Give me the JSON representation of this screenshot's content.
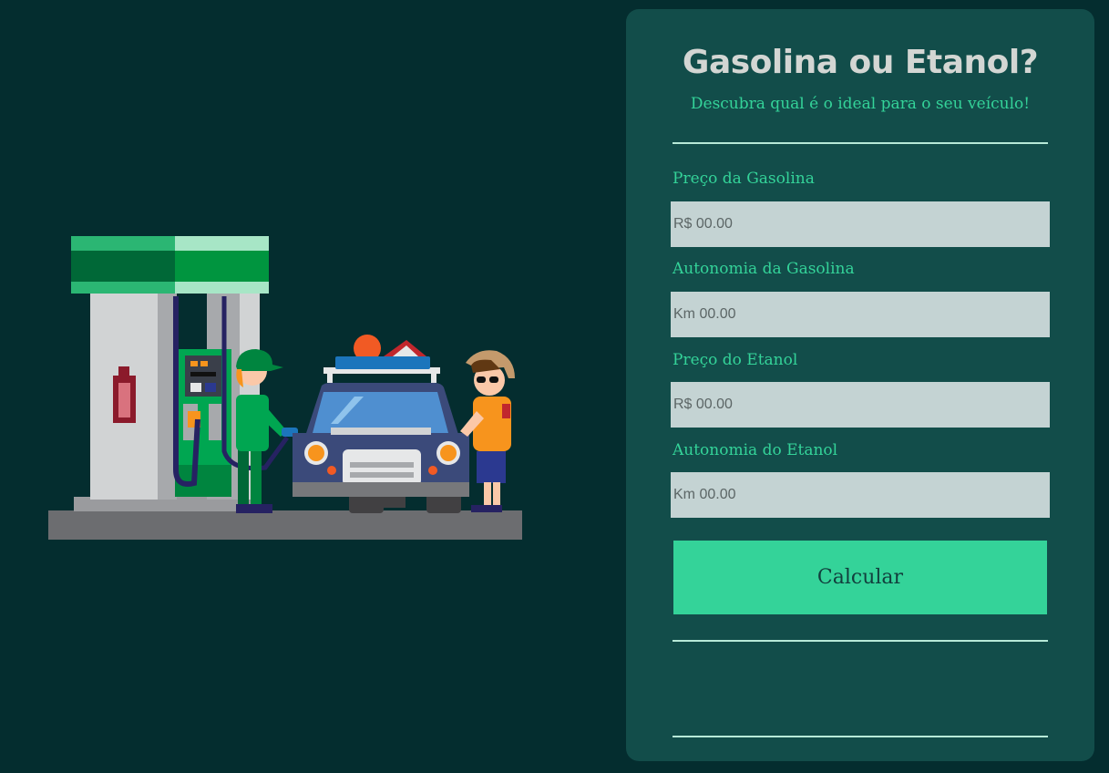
{
  "form": {
    "title": "Gasolina ou Etanol?",
    "subtitle": "Descubra qual é o ideal para o seu veículo!",
    "gasoline_price_label": "Preço da Gasolina",
    "gasoline_price_placeholder": "R$ 00.00",
    "gasoline_range_label": "Autonomia da Gasolina",
    "gasoline_range_placeholder": "Km 00.00",
    "ethanol_price_label": "Preço do Etanol",
    "ethanol_price_placeholder": "R$ 00.00",
    "ethanol_range_label": "Autonomia do Etanol",
    "ethanol_range_placeholder": "Km 00.00",
    "calculate_label": "Calcular",
    "result_text": ""
  },
  "colors": {
    "background": "#042d2f",
    "panel": "#124d4a",
    "accent": "#34d399",
    "input": "#c4d3d3",
    "title": "#d3d6d3"
  },
  "illustration": {
    "icons": [
      "fuel-pump-icon",
      "fire-extinguisher-icon",
      "attendant-icon",
      "car-icon",
      "driver-icon"
    ]
  }
}
